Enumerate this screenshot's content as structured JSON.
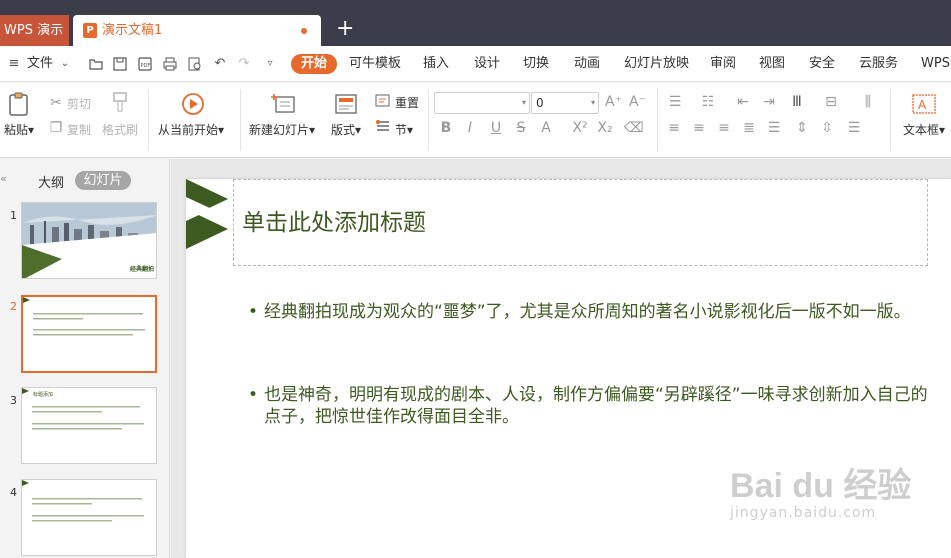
{
  "titlebar": {
    "app_tab": "WPS 演示",
    "doc_tab": "演示文稿1",
    "doc_icon": "P",
    "new_tab": "+"
  },
  "menubar": {
    "file": "文件",
    "tabs": [
      "开始",
      "可牛模板",
      "插入",
      "设计",
      "切换",
      "动画",
      "幻灯片放映",
      "审阅",
      "视图",
      "安全",
      "云服务",
      "WPS会"
    ]
  },
  "ribbon": {
    "paste": "粘贴",
    "cut": "剪切",
    "copy": "复制",
    "format_painter": "格式刷",
    "from_current": "从当前开始",
    "new_slide": "新建幻灯片",
    "layout": "版式",
    "reset": "重置",
    "section": "节",
    "font_name": "",
    "font_size": "0",
    "textbox": "文本框"
  },
  "leftpane": {
    "collapse": "«",
    "tab_outline": "大纲",
    "tab_slides": "幻灯片",
    "thumb_numbers": [
      "1",
      "2",
      "3",
      "4"
    ],
    "thumb1_caption": "经典翻拍",
    "thumb3_title": "标题添加"
  },
  "slide": {
    "title_placeholder": "单击此处添加标题",
    "bullets": [
      "经典翻拍现成为观众的“噩梦”了，尤其是众所周知的著名小说影视化后一版不如一版。",
      "也是神奇，明明有现成的剧本、人设，制作方偏偏要“另辟蹊径”一味寻求创新加入自己的点子，把惊世佳作改得面目全非。"
    ]
  },
  "watermark": {
    "logo": "Bai du 经验",
    "url": "jingyan.baidu.com"
  },
  "colors": {
    "accent": "#e8692c",
    "titlebar": "#3b3d4a",
    "wps_tab": "#c6553a",
    "slide_green": "#3d5a20"
  }
}
